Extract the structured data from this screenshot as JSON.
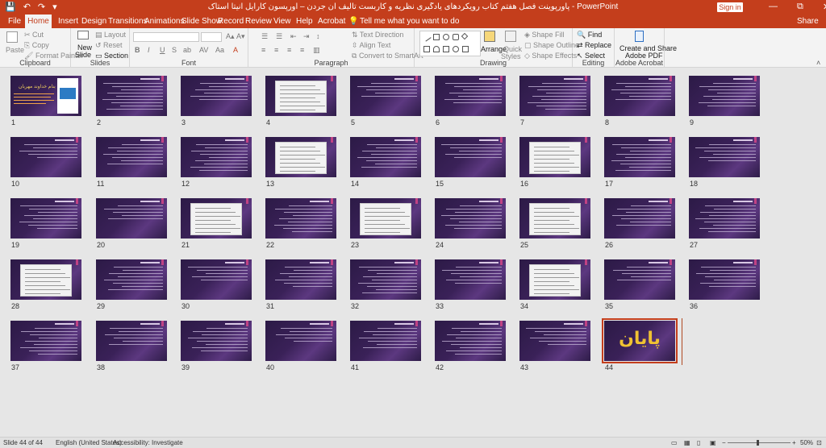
{
  "window": {
    "title": "پاورپوینت فصل هفتم کتاب رویکردهای یادگیری نظریه و کاربست تالیف آن جردن – اورپسون کارایل آنیتا استاک  -  PowerPoint",
    "signin": "Sign in",
    "share": "Share",
    "qat": [
      "💾",
      "↶",
      "↷",
      "▾"
    ],
    "controls": [
      "—",
      "⧉",
      "✕"
    ]
  },
  "tabs": [
    "File",
    "Home",
    "Insert",
    "Design",
    "Transitions",
    "Animations",
    "Slide Show",
    "Record",
    "Review",
    "View",
    "Help",
    "Acrobat"
  ],
  "tellme": "Tell me what you want to do",
  "ribbon": {
    "clipboard": {
      "paste": "Paste",
      "cut": "Cut",
      "copy": "Copy",
      "painter": "Format Painter",
      "label": "Clipboard"
    },
    "slides": {
      "new": "New",
      "new2": "Slide",
      "layout": "Layout",
      "reset": "Reset",
      "section": "Section",
      "label": "Slides"
    },
    "font": {
      "label": "Font",
      "buttons": [
        "B",
        "I",
        "U",
        "S",
        "ab",
        "AV",
        "Aa",
        "A"
      ]
    },
    "paragraph": {
      "dir": "Text Direction",
      "align": "Align Text",
      "smartart": "Convert to SmartArt",
      "label": "Paragraph"
    },
    "drawing": {
      "arrange": "Arrange",
      "quick": "Quick",
      "quick2": "Styles",
      "fill": "Shape Fill",
      "outline": "Shape Outline",
      "effects": "Shape Effects",
      "label": "Drawing"
    },
    "editing": {
      "find": "Find",
      "replace": "Replace",
      "select": "Select",
      "label": "Editing"
    },
    "acrobat": {
      "create": "Create and Share",
      "create2": "Adobe PDF",
      "label": "Adobe Acrobat"
    }
  },
  "slides": {
    "count": 44,
    "selected": 44,
    "cover_title": "بنام خداوند مهربان",
    "final_text": "پایان",
    "white_image_slides": [
      4,
      13,
      16,
      21,
      23,
      25,
      28,
      34
    ]
  },
  "status": {
    "slide": "Slide 44 of 44",
    "language": "English (United States)",
    "accessibility": "Accessibility: Investigate",
    "zoom": "50%"
  }
}
